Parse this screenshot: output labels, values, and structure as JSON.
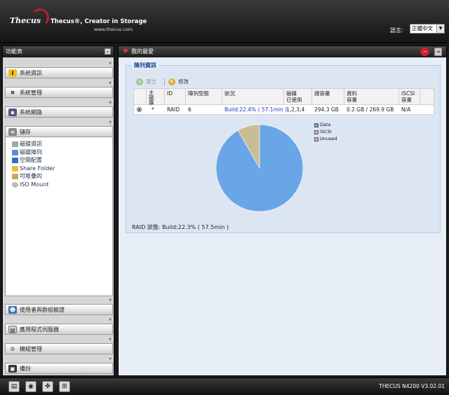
{
  "header": {
    "logo_text": "Thecus",
    "tagline": "Thecus®, Creator in Storage",
    "site_url": "www.thecus.com",
    "language_label": "語言:",
    "language_value": "正體中文"
  },
  "sidebar": {
    "title": "功能表",
    "sections": [
      {
        "label": "系統資訊",
        "icon": "info-icon"
      },
      {
        "label": "系統管理",
        "icon": "tools-icon"
      },
      {
        "label": "系統網路",
        "icon": "network-icon"
      },
      {
        "label": "儲存",
        "icon": "storage-icon"
      }
    ],
    "storage_items": [
      {
        "label": "磁碟資訊",
        "icon": "disk-info-icon"
      },
      {
        "label": "磁碟陣列",
        "icon": "raid-icon"
      },
      {
        "label": "空間配置",
        "icon": "space-allocation-icon"
      },
      {
        "label": "Share Folder",
        "icon": "folder-icon"
      },
      {
        "label": "可堆疊的",
        "icon": "stackable-icon"
      },
      {
        "label": "ISO Mount",
        "icon": "iso-icon"
      }
    ],
    "bottom_sections": [
      {
        "label": "使用者與群組驗證",
        "icon": "users-icon"
      },
      {
        "label": "應用程式伺服器",
        "icon": "app-server-icon"
      },
      {
        "label": "模組管理",
        "icon": "module-icon"
      },
      {
        "label": "備份",
        "icon": "backup-icon"
      }
    ]
  },
  "main": {
    "title": "我的最愛",
    "panel_title": "陣列資訊",
    "toolbar": {
      "add_label": "建立",
      "edit_label": "修改"
    },
    "table": {
      "headers": {
        "master": "主\n磁\n碟",
        "id": "ID",
        "raid_level": "陣列型態",
        "status": "狀況",
        "disks_used": "磁碟\n已使用",
        "total_capacity": "總容量",
        "data_capacity": "資料\n容量",
        "iscsi_capacity": "iSCSI\n容量"
      },
      "row": {
        "master": "*",
        "id": "RAID",
        "raid_level": "6",
        "status": "Build:22.4% ( 57.1min )",
        "disks_used": "1,2,3,4",
        "total_capacity": "294.3 GB",
        "data_capacity": "0.2 GB / 269.9 GB",
        "iscsi_capacity": "N/A"
      }
    },
    "raid_status": "RAID 狀態: Build:22.3% ( 57.5min )"
  },
  "chart_data": {
    "type": "pie",
    "categories": [
      "Data",
      "iSCSI",
      "Unused"
    ],
    "values": [
      269.9,
      0,
      24.4
    ],
    "colors": [
      "#6aa6e6",
      "#c9aee8",
      "#c9bd95"
    ],
    "legend_position": "top-right"
  },
  "footer": {
    "version": "THECUS N4200 V3.02.01"
  }
}
